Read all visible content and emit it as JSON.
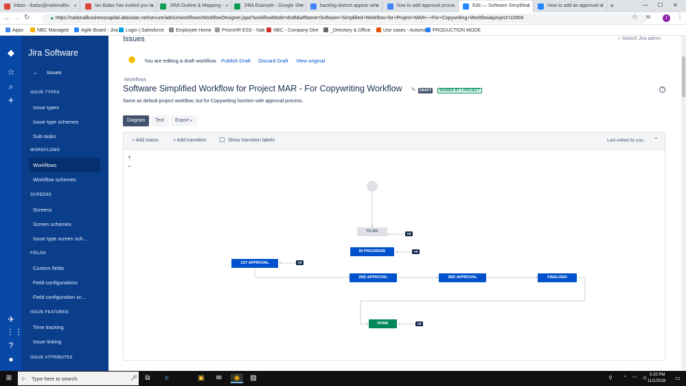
{
  "browser": {
    "tabs": [
      {
        "label": "Inbox - ibalas@nationalbu",
        "color": "#db4437"
      },
      {
        "label": "Ian Balas has invited you to",
        "color": "#db4437"
      },
      {
        "label": "JIRA Outline & Mapping - ",
        "color": "#0f9d58"
      },
      {
        "label": "JIRA Example - Google She",
        "color": "#0f9d58"
      },
      {
        "label": "backlog doesnt appear whe",
        "color": "#4285f4"
      },
      {
        "label": "how to add approval proce",
        "color": "#4285f4"
      },
      {
        "label": "Edit — Software Simplified",
        "color": "#2684ff"
      },
      {
        "label": "How to add an approval st",
        "color": "#2684ff"
      }
    ],
    "new_tab": "+",
    "window_controls": [
      "—",
      "☐",
      "✕"
    ],
    "url": "https://nationalbusinesscapital.atlassian.net/secure/admin/workflows/WorkflowDesigner.jspa?workflowMode=draft&wfName=Software+Simplified+Workflow+for+Project+MAR+-+For+Copywriting+Workflow&project=10004",
    "profile_label": "M.",
    "profile_initial": "I",
    "bookmarks": [
      {
        "label": "Apps",
        "color": "#4285f4"
      },
      {
        "label": "NBC Managed",
        "color": "#f4b400"
      },
      {
        "label": "Agile Board - Jira",
        "color": "#2684ff"
      },
      {
        "label": "Login | Salesforce",
        "color": "#00a1e0"
      },
      {
        "label": "Employee Home",
        "color": "#888888"
      },
      {
        "label": "PrismHR ESS - Nati",
        "color": "#999999"
      },
      {
        "label": "NBC - Company Dire",
        "color": "#d32f2f"
      },
      {
        "label": "_Directory & Office",
        "color": "#666666"
      },
      {
        "label": "Use cases - Automat",
        "color": "#e65100"
      },
      {
        "label": "PRODUCTION MODE",
        "color": "#2684ff"
      }
    ]
  },
  "sidebar": {
    "product": "Jira Software",
    "back_label": "Issues",
    "sections": [
      {
        "title": "ISSUE TYPES",
        "items": [
          "Issue types",
          "Issue type schemes",
          "Sub-tasks"
        ]
      },
      {
        "title": "WORKFLOWS",
        "items": [
          "Workflows",
          "Workflow schemes"
        ]
      },
      {
        "title": "SCREENS",
        "items": [
          "Screens",
          "Screen schemes",
          "Issue type screen sch..."
        ]
      },
      {
        "title": "FIELDS",
        "items": [
          "Custom fields",
          "Field configurations",
          "Field configuration sc..."
        ]
      },
      {
        "title": "ISSUE FEATURES",
        "items": [
          "Time tracking",
          "Issue linking"
        ]
      },
      {
        "title": "ISSUE ATTRIBUTES",
        "items": []
      }
    ],
    "selected": "Workflows"
  },
  "page": {
    "header": "Issues",
    "search_placeholder": "Search Jira admin",
    "draft_notice": "You are editing a draft workflow.",
    "publish_draft": "Publish Draft",
    "discard_draft": "Discard Draft",
    "view_original": "View original",
    "breadcrumb": "Workflows",
    "title": "Software Simplified Workflow for Project MAR - For Copywriting Workflow",
    "draft_badge": "DRAFT",
    "shared_badge": "SHARED BY 1 PROJECT",
    "description": "Same as default project workflow, but for Copywriting function with approval process.",
    "view_tabs": [
      "Diagram",
      "Text"
    ],
    "export_label": "Export",
    "add_status": "Add status",
    "add_transition": "Add transition",
    "show_labels": "Show transition labels",
    "last_edited": "Last edited by you,",
    "zoom_in": "+",
    "zoom_out": "−"
  },
  "workflow": {
    "statuses": [
      "TO DO",
      "IN PROGRESS",
      "1ST APPROVAL",
      "2ND APPROVAL",
      "3RD APPROVAL",
      "FINALIZED",
      "DONE"
    ],
    "all_badge": "All",
    "colors": {
      "todo": "#dfe1e6",
      "inprogress": "#0052cc",
      "done": "#00875a",
      "badge": "#172b4d"
    }
  },
  "taskbar": {
    "search_placeholder": "Type here to search",
    "time": "5:20 PM",
    "date": "11/1/2018"
  }
}
